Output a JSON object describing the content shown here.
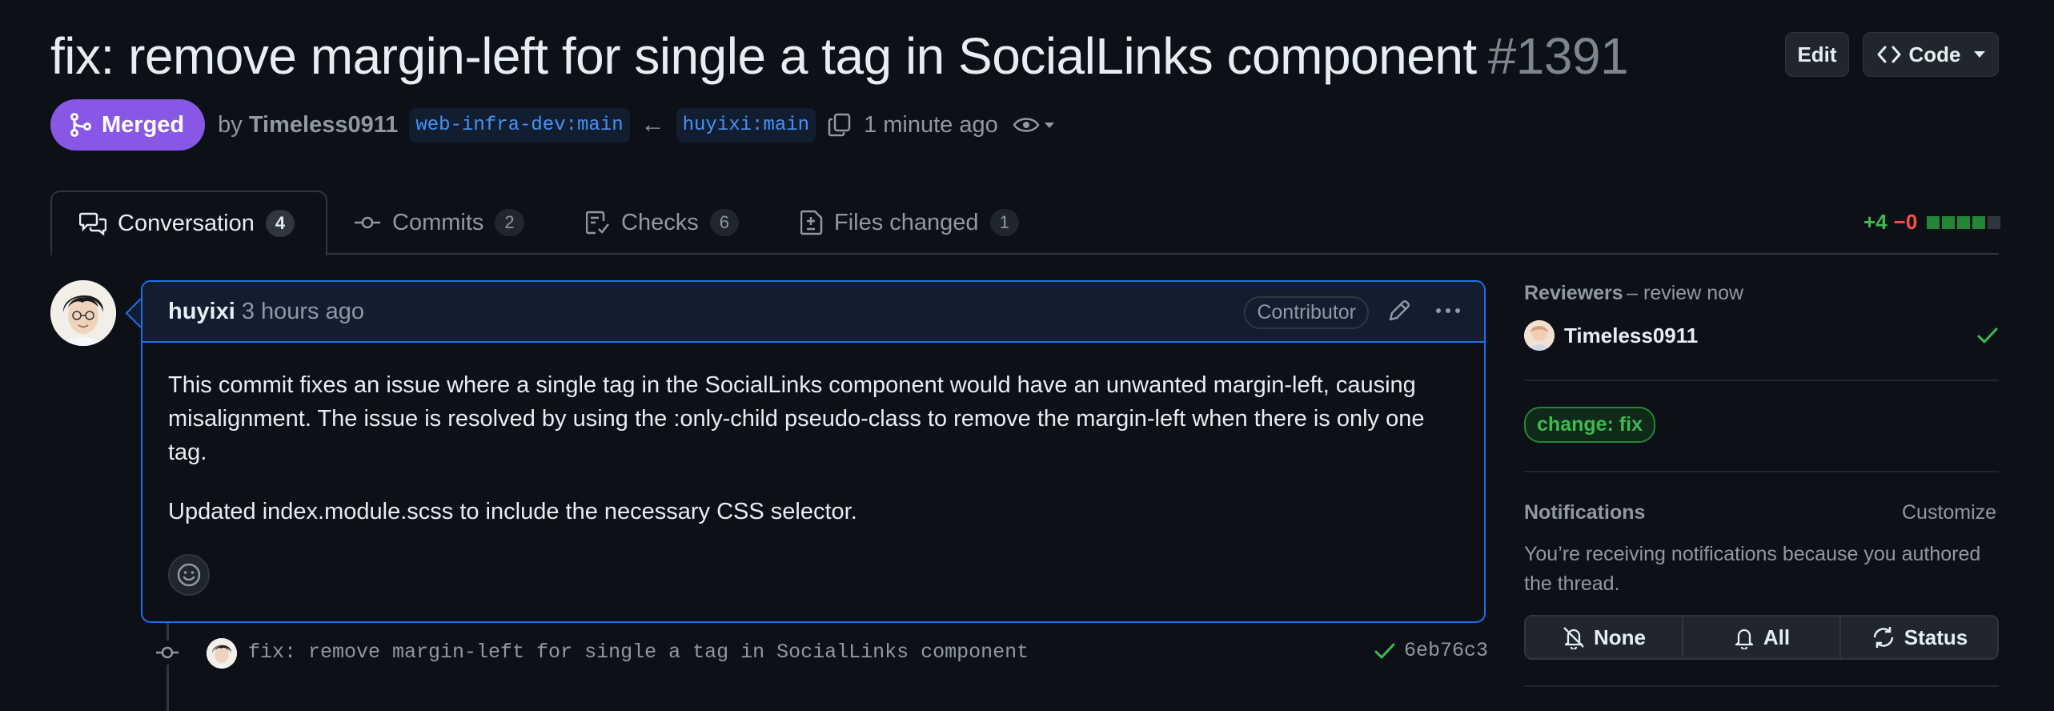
{
  "header": {
    "title": "fix: remove margin-left for single a tag in SocialLinks component",
    "number": "#1391",
    "edit_label": "Edit",
    "code_label": "Code"
  },
  "meta": {
    "status": "Merged",
    "by": "by",
    "author": "Timeless0911",
    "base_branch": "web-infra-dev:main",
    "head_branch": "huyixi:main",
    "time": "1 minute ago"
  },
  "tabs": [
    {
      "label": "Conversation",
      "count": "4"
    },
    {
      "label": "Commits",
      "count": "2"
    },
    {
      "label": "Checks",
      "count": "6"
    },
    {
      "label": "Files changed",
      "count": "1"
    }
  ],
  "diffstat": {
    "additions": "+4",
    "deletions": "−0"
  },
  "comment": {
    "author": "huyixi",
    "time": "3 hours ago",
    "role": "Contributor",
    "body_p1": "This commit fixes an issue where a single tag in the SocialLinks component would have an unwanted margin-left, causing misalignment. The issue is resolved by using the :only-child pseudo-class to remove the margin-left when there is only one tag.",
    "body_p2": "Updated index.module.scss to include the necessary CSS selector."
  },
  "commit": {
    "message": "fix: remove margin-left for single a tag in SocialLinks component",
    "sha": "6eb76c3"
  },
  "sidebar": {
    "reviewers_heading": "Reviewers",
    "reviewers_sub": "– review now",
    "reviewer": "Timeless0911",
    "label": "change: fix",
    "notifications_heading": "Notifications",
    "customize": "Customize",
    "notif_desc": "You’re receiving notifications because you authored the thread.",
    "notif_none": "None",
    "notif_all": "All",
    "notif_status": "Status"
  },
  "colors": {
    "merged": "#8957e5",
    "accent_blue": "#1f6feb",
    "success": "#3fb950",
    "danger": "#f85149"
  }
}
